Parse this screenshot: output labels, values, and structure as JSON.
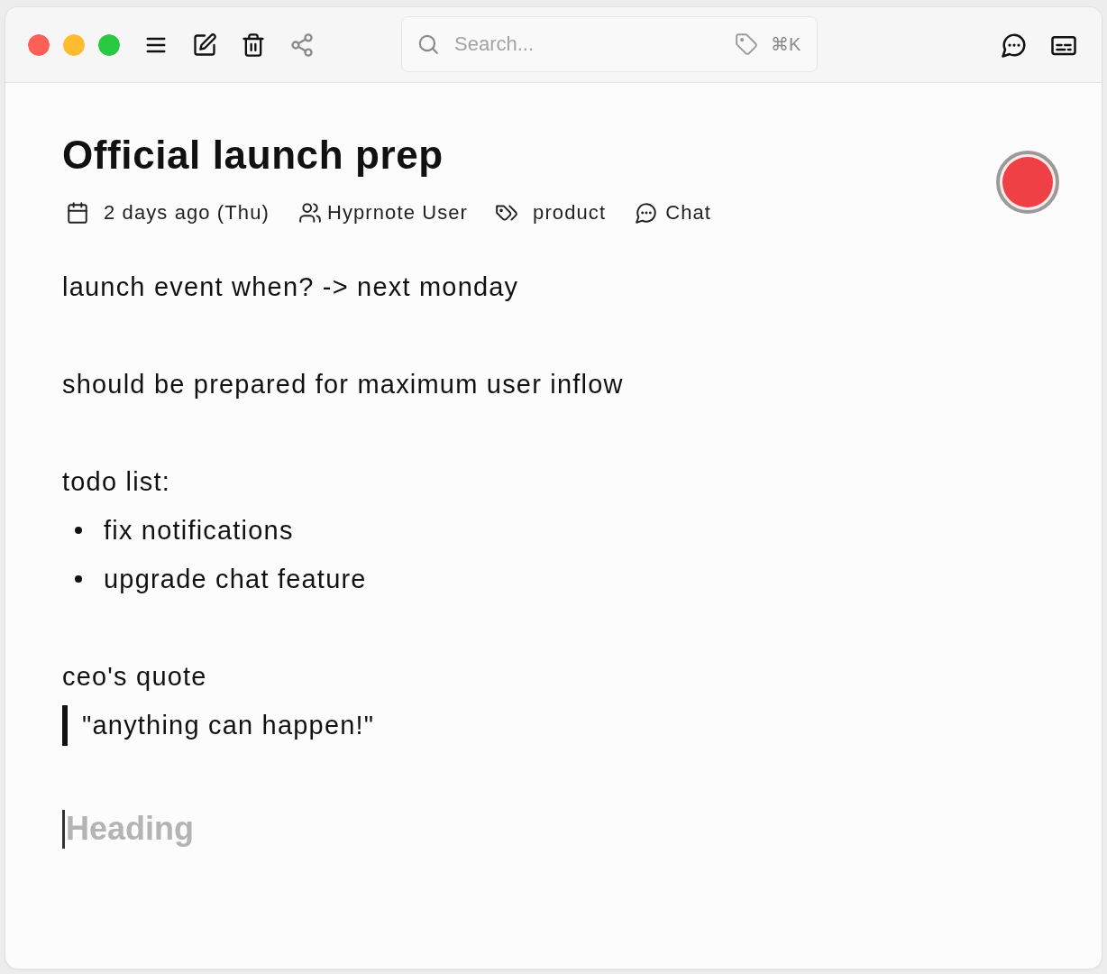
{
  "toolbar": {
    "buttons": [
      {
        "kind": "sidebar",
        "disabled": false
      },
      {
        "kind": "new_note",
        "disabled": false
      },
      {
        "kind": "delete",
        "disabled": false
      },
      {
        "kind": "share",
        "disabled": true
      }
    ],
    "search": {
      "placeholder": "Search...",
      "shortcut": "⌘K"
    },
    "right_buttons": [
      {
        "kind": "chat"
      },
      {
        "kind": "panel"
      }
    ]
  },
  "note": {
    "title": "Official launch prep",
    "meta": [
      {
        "kind": "date",
        "text": "2 days ago (Thu)"
      },
      {
        "kind": "participants",
        "text": "Hyprnote User"
      },
      {
        "kind": "tags",
        "text": "product"
      },
      {
        "kind": "chat",
        "text": "Chat"
      }
    ],
    "blocks": [
      {
        "kind": "paragraph",
        "text": "launch event when? -> next monday"
      },
      {
        "kind": "blank"
      },
      {
        "kind": "paragraph",
        "text": "should be prepared for maximum user inflow"
      },
      {
        "kind": "blank"
      },
      {
        "kind": "paragraph",
        "text": "todo list:"
      },
      {
        "kind": "bullet",
        "text": "fix notifications"
      },
      {
        "kind": "bullet",
        "text": "upgrade chat feature"
      },
      {
        "kind": "blank"
      },
      {
        "kind": "paragraph",
        "text": "ceo's quote"
      },
      {
        "kind": "quote",
        "text": "\"anything can happen!\""
      },
      {
        "kind": "blank"
      },
      {
        "kind": "heading",
        "placeholder": "Heading",
        "focused": true
      }
    ]
  }
}
